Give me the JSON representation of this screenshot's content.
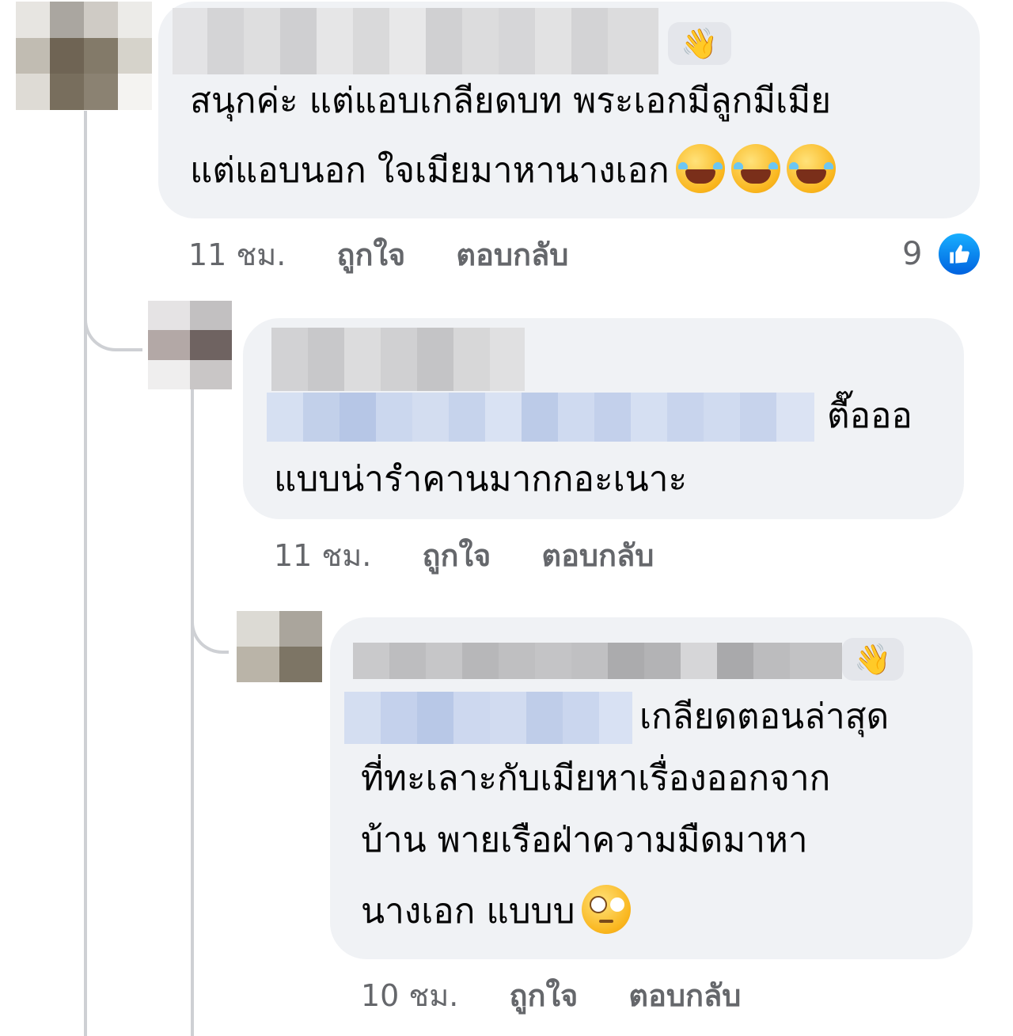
{
  "comments": [
    {
      "text_lines": [
        "สนุกค่ะ แต่แอบเกลียดบท พระเอกมีลูกมีเมีย",
        "แต่แอบนอก ใจเมียมาหานางเอก"
      ],
      "reaction_emoji": "face-with-tears-of-joy",
      "badge_icon": "waving-hand-icon",
      "time": "11 ชม.",
      "like_label": "ถูกใจ",
      "reply_label": "ตอบกลับ",
      "like_count": "9"
    },
    {
      "text_lines": [
        "ตื๊อออ",
        "แบบน่ารำคานมากกอะเนาะ"
      ],
      "time": "11 ชม.",
      "like_label": "ถูกใจ",
      "reply_label": "ตอบกลับ"
    },
    {
      "text_lines": [
        "เกลียดตอนล่าสุด",
        "ที่ทะเลาะกับเมียหาเรื่องออกจาก",
        "บ้าน พายเรือฝ่าความมืดมาหา",
        "นางเอก แบบบ"
      ],
      "reaction_emoji": "face-with-rolling-eyes",
      "badge_icon": "waving-hand-icon",
      "time": "10 ชม.",
      "like_label": "ถูกใจ",
      "reply_label": "ตอบกลับ"
    }
  ],
  "colors": {
    "bubble": "#f0f2f5",
    "meta_text": "#65676b",
    "like_blue": "#1877f2",
    "tag_blue": "#c5d4ef",
    "thread_line": "#ced0d4"
  }
}
